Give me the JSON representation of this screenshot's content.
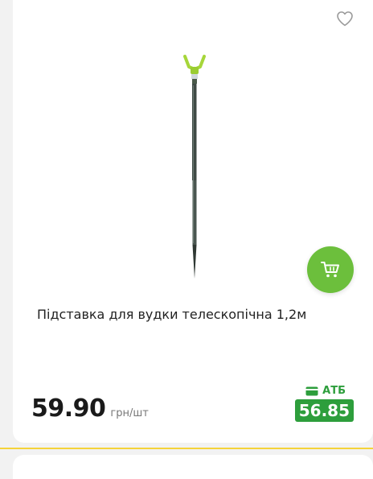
{
  "product": {
    "title": "Підставка для вудки телескопічна 1,2м",
    "price": "59.90",
    "unit": "грн/шт",
    "image_icon": "telescopic-rod-holder"
  },
  "club": {
    "label": "АТБ",
    "price": "56.85",
    "icon": "card-icon"
  },
  "actions": {
    "favorite_icon": "heart-outline-icon",
    "cart_icon": "cart-icon"
  },
  "colors": {
    "accent_green": "#6cbf3c",
    "atb_green": "#2d9e3c",
    "separator_yellow": "#f5d33a"
  }
}
